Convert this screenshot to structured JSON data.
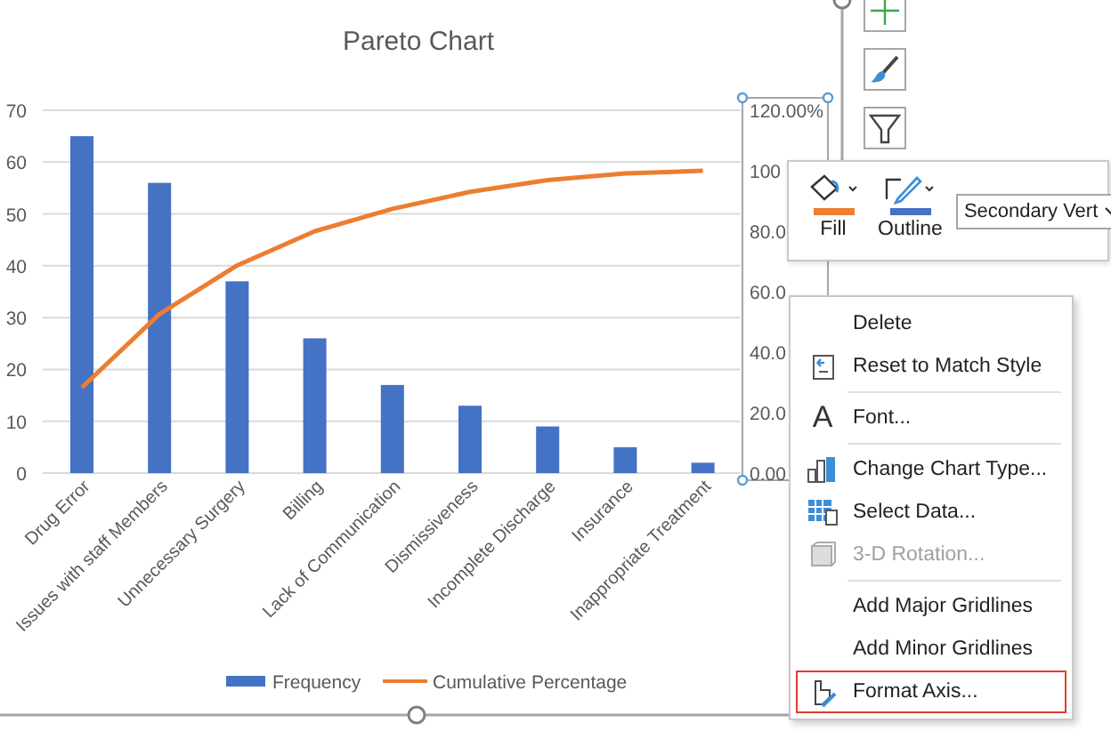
{
  "chart": {
    "bars": {
      "chart_data": {
        "type": "bar",
        "title": "Pareto Chart",
        "grid": true,
        "categories": [
          "Drug Error",
          "Issues with staff Members",
          "Unnecessary Surgery",
          "Billing",
          "Lack of Communication",
          "Dismissiveness",
          "Incomplete Discharge",
          "Insurance",
          "Inappropriate Treatment"
        ],
        "series": [
          {
            "name": "Frequency",
            "color": "#4472c4",
            "values": [
              65,
              56,
              37,
              26,
              17,
              13,
              9,
              5,
              2
            ]
          }
        ],
        "ylim": [
          0,
          70
        ],
        "yticks": [
          0,
          10,
          20,
          30,
          40,
          50,
          60,
          70
        ]
      }
    },
    "cumulative_line": {
      "chart_data": {
        "type": "line",
        "ylim": [
          0,
          120
        ],
        "yticks": [
          {
            "value": 120,
            "label": "120.00%"
          },
          {
            "value": 100,
            "label": "100"
          },
          {
            "value": 80,
            "label": "80.0"
          },
          {
            "value": 60,
            "label": "60.0"
          },
          {
            "value": 40,
            "label": "40.0"
          },
          {
            "value": 20,
            "label": "20.0"
          },
          {
            "value": 0,
            "label": "0.00"
          }
        ],
        "series": [
          {
            "name": "Cumulative Percentage",
            "color": "#ed7d31",
            "values": [
              28.3,
              52.6,
              68.7,
              80,
              87.4,
              93,
              96.9,
              99.1,
              100
            ]
          }
        ]
      }
    }
  },
  "mini_toolbar": {
    "buttons": [
      {
        "label": "Fill",
        "color": "#ed7d31"
      },
      {
        "label": "Outline",
        "color": "#4472c4"
      }
    ],
    "dropdown": {
      "value": "Secondary Vert"
    }
  },
  "context_menu": {
    "items": [
      {
        "kind": "item",
        "label": "Delete",
        "disabled": false,
        "selected": false
      },
      {
        "kind": "item",
        "label": "Reset to Match Style",
        "disabled": false,
        "selected": false
      },
      {
        "kind": "separator"
      },
      {
        "kind": "item",
        "glyph": "A",
        "label": "Font...",
        "disabled": false,
        "selected": false
      },
      {
        "kind": "separator"
      },
      {
        "kind": "item",
        "label": "Change Chart Type...",
        "disabled": false,
        "selected": false
      },
      {
        "kind": "item",
        "label": "Select Data...",
        "disabled": false,
        "selected": false
      },
      {
        "kind": "item",
        "label": "3-D Rotation...",
        "disabled": true,
        "selected": false
      },
      {
        "kind": "separator"
      },
      {
        "kind": "item",
        "label": "Add Major Gridlines",
        "disabled": false,
        "selected": false
      },
      {
        "kind": "item",
        "label": "Add Minor Gridlines",
        "disabled": false,
        "selected": false
      },
      {
        "kind": "item",
        "label": "Format Axis...",
        "disabled": false,
        "selected": true
      }
    ]
  }
}
